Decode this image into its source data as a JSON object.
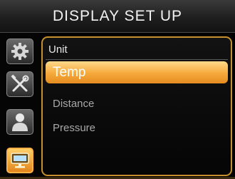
{
  "header": {
    "title": "DISPLAY SET UP"
  },
  "sidebar": {
    "items": [
      {
        "icon": "gear-icon",
        "active": false
      },
      {
        "icon": "tools-icon",
        "active": false
      },
      {
        "icon": "user-icon",
        "active": false
      },
      {
        "icon": "display-icon",
        "active": true
      }
    ]
  },
  "panel": {
    "title": "Unit",
    "options": [
      {
        "label": "Temp",
        "selected": true
      },
      {
        "label": "Distance",
        "selected": false
      },
      {
        "label": "Pressure",
        "selected": false
      }
    ]
  },
  "colors": {
    "accent": "#f6a93c",
    "frame": "#c7902c"
  }
}
